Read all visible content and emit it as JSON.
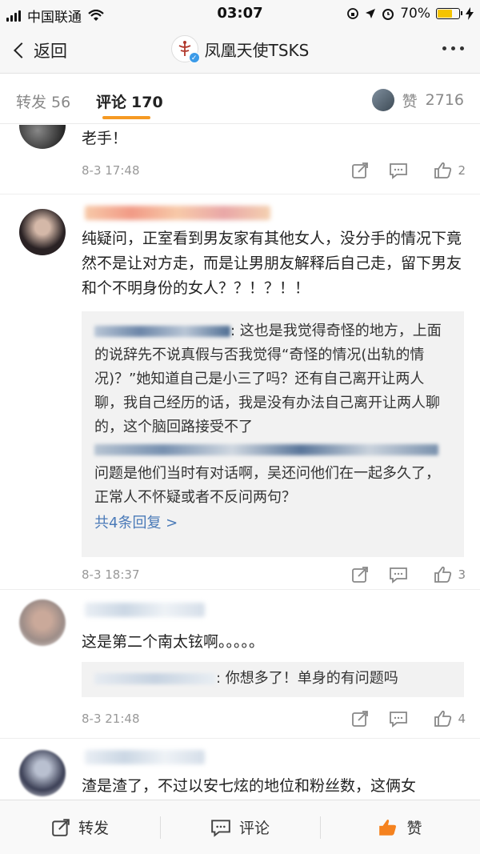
{
  "status_bar": {
    "carrier": "中国联通",
    "time": "03:07",
    "battery": "70%",
    "battery_level": 0.7
  },
  "nav": {
    "back_label": "返回",
    "title": "凤凰天使TSKS"
  },
  "tabs": {
    "repost_label": "转发",
    "repost_count": "56",
    "comment_label": "评论",
    "comment_count": "170",
    "like_label": "赞",
    "like_count": "2716"
  },
  "comments": [
    {
      "text": "老手！",
      "date": "8-3 17:48",
      "likes": "2"
    },
    {
      "text": "纯疑问，正室看到男友家有其他女人，没分手的情况下竟然不是让对方走，而是让男朋友解释后自己走，留下男友和个不明身份的女人？？！？！！",
      "date": "8-3 18:37",
      "likes": "3",
      "replies": [
        ": 这也是我觉得奇怪的地方，上面的说辞先不说真假与否我觉得“奇怪的情况(出轨的情况)？”她知道自己是小三了吗？还有自己离开让两人聊，我自己经历的话，我是没有办法自己离开让两人聊的，这个脑回路接受不了",
        "问题是他们当时有对话啊，吴还问他们在一起多久了，正常人不怀疑或者不反问两句？"
      ],
      "more_replies": "共4条回复 >"
    },
    {
      "text": "这是第二个南太铉啊。。。。。",
      "date": "8-3 21:48",
      "likes": "4",
      "reply": ": 你想多了！单身的有问题吗"
    },
    {
      "text": "渣是渣了，不过以安七炫的地位和粉丝数，这俩女"
    }
  ],
  "bottom_bar": {
    "repost": "转发",
    "comment": "评论",
    "like": "赞"
  },
  "colors": {
    "accent": "#f59a23",
    "link": "#4a7ab8",
    "like_active": "#f5821f"
  }
}
